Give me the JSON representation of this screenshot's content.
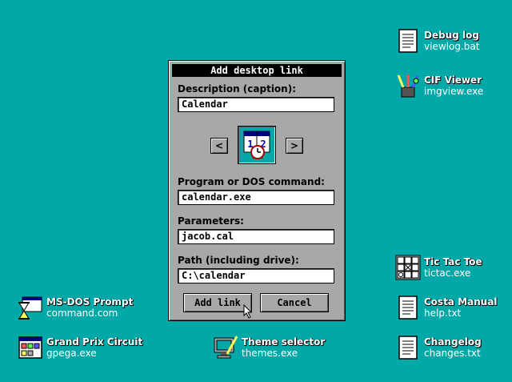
{
  "dialog": {
    "title": "Add desktop link",
    "description_label": "Description (caption):",
    "description_value": "Calendar",
    "program_label": "Program or DOS command:",
    "program_value": "calendar.exe",
    "parameters_label": "Parameters:",
    "parameters_value": "jacob.cal",
    "path_label": "Path (including drive):",
    "path_value": "C:\\calendar",
    "prev_icon": "<",
    "next_icon": ">",
    "preview_icon": "calendar-icon",
    "add_label": "Add link",
    "cancel_label": "Cancel"
  },
  "desktop_icons": [
    {
      "title": "Debug log",
      "file": "viewlog.bat",
      "icon": "document-icon"
    },
    {
      "title": "CIF Viewer",
      "file": "imgview.exe",
      "icon": "paint-brushes-icon"
    },
    {
      "title": "Tic Tac Toe",
      "file": "tictac.exe",
      "icon": "tic-tac-toe-icon"
    },
    {
      "title": "MS-DOS Prompt",
      "file": "command.com",
      "icon": "hourglass-window-icon"
    },
    {
      "title": "Costa Manual",
      "file": "help.txt",
      "icon": "document-icon"
    },
    {
      "title": "Grand Prix Circuit",
      "file": "gpega.exe",
      "icon": "program-window-icon"
    },
    {
      "title": "Theme selector",
      "file": "themes.exe",
      "icon": "monitor-paint-icon"
    },
    {
      "title": "Changelog",
      "file": "changes.txt",
      "icon": "document-icon"
    }
  ],
  "colors": {
    "desktop": "#00a8a8",
    "dialog": "#a8a8a8",
    "titlebar": "#000000"
  }
}
